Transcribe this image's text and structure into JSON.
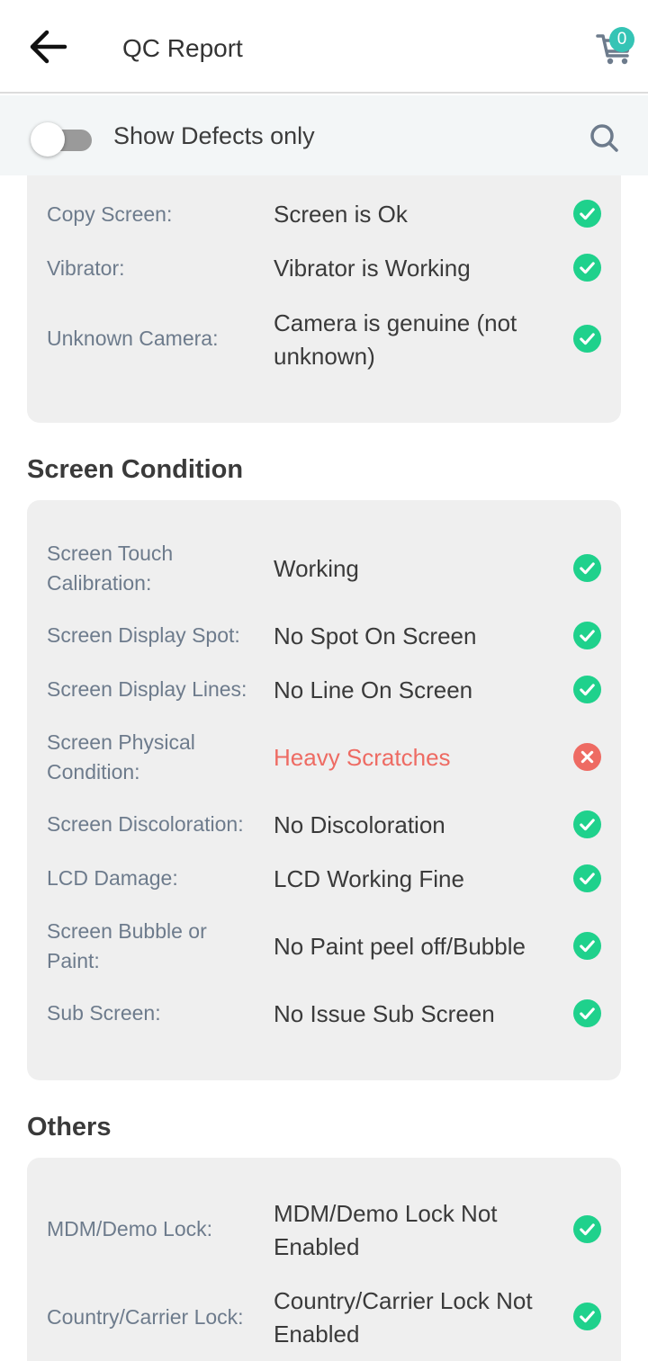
{
  "header": {
    "title": "QC Report",
    "cart_count": "0"
  },
  "filter": {
    "label": "Show Defects only",
    "enabled": false
  },
  "colors": {
    "pass": "#1fd18c",
    "fail": "#ee6b63",
    "accent": "#35c4b5"
  },
  "icons": {
    "back": "arrow-left-icon",
    "cart": "shopping-cart-icon",
    "search": "search-icon",
    "pass": "check-circle-icon",
    "fail": "x-circle-icon"
  },
  "sections": [
    {
      "title": "",
      "rows": [
        {
          "label": "Copy Screen:",
          "value": "Screen is Ok",
          "status": "pass"
        },
        {
          "label": "Vibrator:",
          "value": "Vibrator is Working",
          "status": "pass"
        },
        {
          "label": "Unknown Camera:",
          "value": "Camera is genuine (not unknown)",
          "status": "pass"
        }
      ]
    },
    {
      "title": "Screen Condition",
      "rows": [
        {
          "label": "Screen Touch Calibration:",
          "value": "Working",
          "status": "pass"
        },
        {
          "label": "Screen Display Spot:",
          "value": "No Spot On Screen",
          "status": "pass"
        },
        {
          "label": "Screen Display Lines:",
          "value": "No Line On Screen",
          "status": "pass"
        },
        {
          "label": "Screen Physical Condition:",
          "value": "Heavy Scratches",
          "status": "fail"
        },
        {
          "label": "Screen Discoloration:",
          "value": "No Discoloration",
          "status": "pass"
        },
        {
          "label": "LCD Damage:",
          "value": "LCD Working Fine",
          "status": "pass"
        },
        {
          "label": "Screen Bubble or Paint:",
          "value": "No Paint peel off/Bubble",
          "status": "pass"
        },
        {
          "label": "Sub Screen:",
          "value": "No Issue Sub Screen",
          "status": "pass"
        }
      ]
    },
    {
      "title": "Others",
      "rows": [
        {
          "label": "MDM/Demo Lock:",
          "value": "MDM/Demo Lock Not Enabled",
          "status": "pass"
        },
        {
          "label": "Country/Carrier Lock:",
          "value": "Country/Carrier Lock Not Enabled",
          "status": "pass"
        }
      ]
    }
  ]
}
